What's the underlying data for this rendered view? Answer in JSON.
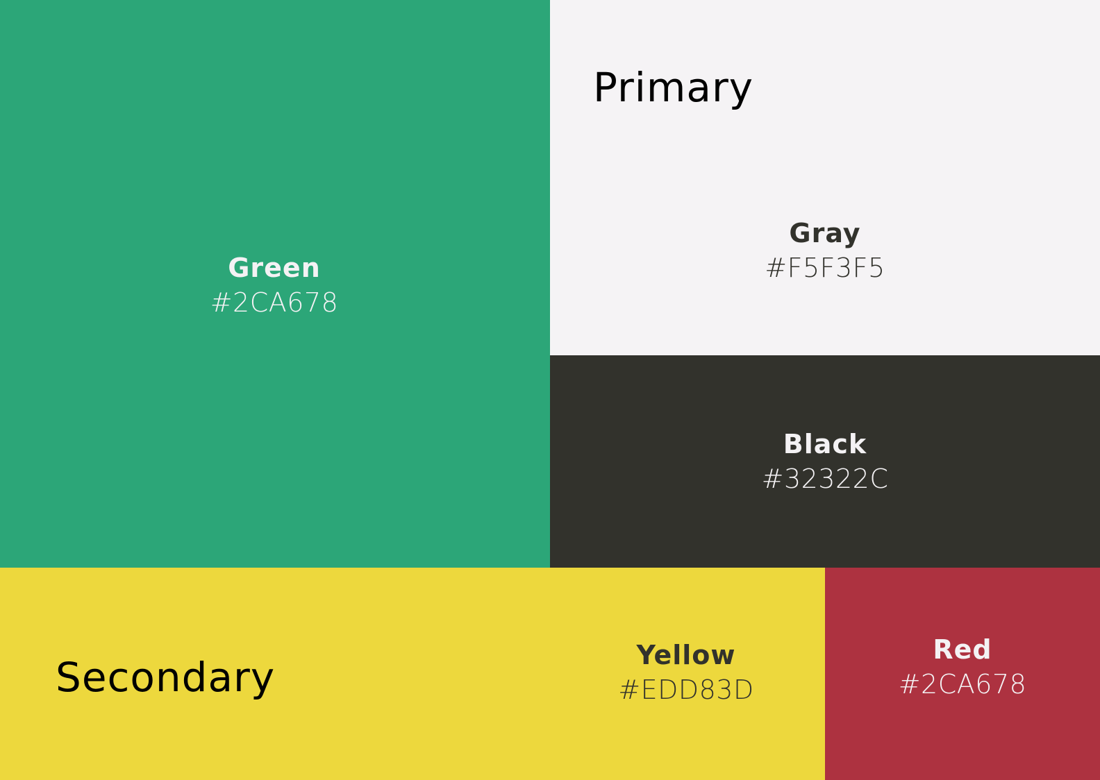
{
  "sections": {
    "primary_title": "Primary",
    "secondary_title": "Secondary"
  },
  "swatches": {
    "green": {
      "name": "Green",
      "hex": "#2CA678",
      "color": "#2CA678"
    },
    "gray": {
      "name": "Gray",
      "hex": "#F5F3F5",
      "color": "#F5F3F5"
    },
    "black": {
      "name": "Black",
      "hex": "#32322C",
      "color": "#32322C"
    },
    "yellow": {
      "name": "Yellow",
      "hex": "#EDD83D",
      "color": "#EDD83D"
    },
    "red": {
      "name": "Red",
      "hex": "#2CA678",
      "color": "#AD3240"
    }
  }
}
